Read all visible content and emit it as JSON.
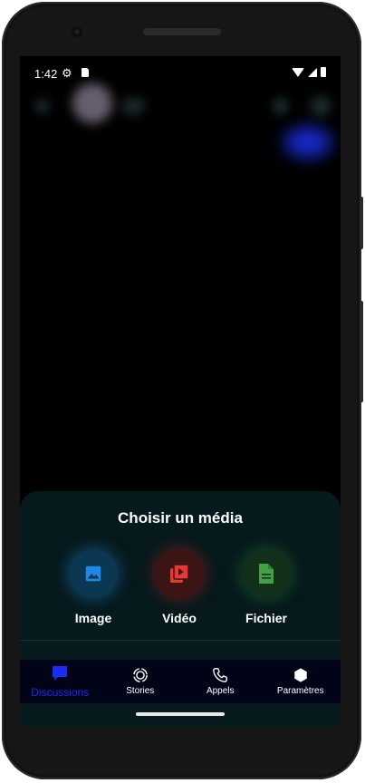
{
  "status_bar": {
    "time": "1:42"
  },
  "sheet": {
    "title": "Choisir un média",
    "options": [
      {
        "label": "Image",
        "icon": "image-icon",
        "color": "#1e88e5"
      },
      {
        "label": "Vidéo",
        "icon": "video-library-icon",
        "color": "#e53935"
      },
      {
        "label": "Fichier",
        "icon": "file-icon",
        "color": "#43a047"
      }
    ]
  },
  "tabs": [
    {
      "label": "Discussions",
      "icon": "chat-bubble-icon",
      "active": true,
      "color": "#1a2cf0"
    },
    {
      "label": "Stories",
      "icon": "stories-icon",
      "active": false
    },
    {
      "label": "Appels",
      "icon": "phone-icon",
      "active": false
    },
    {
      "label": "Paramètres",
      "icon": "hexagon-icon",
      "active": false
    }
  ]
}
